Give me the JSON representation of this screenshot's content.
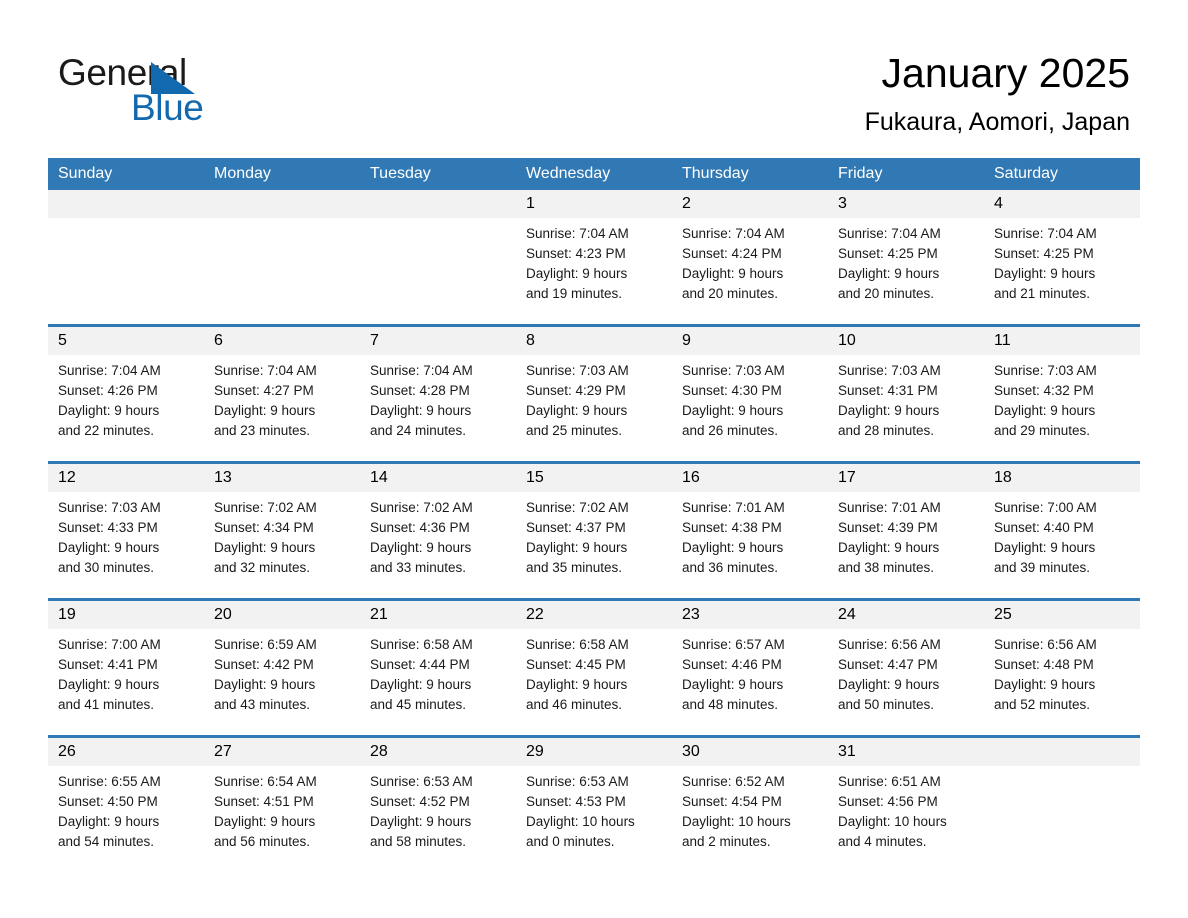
{
  "brand": {
    "name_part1": "General",
    "name_part2": "Blue",
    "logo_icon": "triangle-flag-icon",
    "accent_color": "#1369ad"
  },
  "header": {
    "month_title": "January 2025",
    "location": "Fukaura, Aomori, Japan"
  },
  "calendar": {
    "header_bg": "#3179b4",
    "daynum_bg": "#f2f2f2",
    "weekday_headers": [
      "Sunday",
      "Monday",
      "Tuesday",
      "Wednesday",
      "Thursday",
      "Friday",
      "Saturday"
    ],
    "weeks": [
      [
        {
          "day": "",
          "lines": []
        },
        {
          "day": "",
          "lines": []
        },
        {
          "day": "",
          "lines": []
        },
        {
          "day": "1",
          "lines": [
            "Sunrise: 7:04 AM",
            "Sunset: 4:23 PM",
            "Daylight: 9 hours",
            "and 19 minutes."
          ]
        },
        {
          "day": "2",
          "lines": [
            "Sunrise: 7:04 AM",
            "Sunset: 4:24 PM",
            "Daylight: 9 hours",
            "and 20 minutes."
          ]
        },
        {
          "day": "3",
          "lines": [
            "Sunrise: 7:04 AM",
            "Sunset: 4:25 PM",
            "Daylight: 9 hours",
            "and 20 minutes."
          ]
        },
        {
          "day": "4",
          "lines": [
            "Sunrise: 7:04 AM",
            "Sunset: 4:25 PM",
            "Daylight: 9 hours",
            "and 21 minutes."
          ]
        }
      ],
      [
        {
          "day": "5",
          "lines": [
            "Sunrise: 7:04 AM",
            "Sunset: 4:26 PM",
            "Daylight: 9 hours",
            "and 22 minutes."
          ]
        },
        {
          "day": "6",
          "lines": [
            "Sunrise: 7:04 AM",
            "Sunset: 4:27 PM",
            "Daylight: 9 hours",
            "and 23 minutes."
          ]
        },
        {
          "day": "7",
          "lines": [
            "Sunrise: 7:04 AM",
            "Sunset: 4:28 PM",
            "Daylight: 9 hours",
            "and 24 minutes."
          ]
        },
        {
          "day": "8",
          "lines": [
            "Sunrise: 7:03 AM",
            "Sunset: 4:29 PM",
            "Daylight: 9 hours",
            "and 25 minutes."
          ]
        },
        {
          "day": "9",
          "lines": [
            "Sunrise: 7:03 AM",
            "Sunset: 4:30 PM",
            "Daylight: 9 hours",
            "and 26 minutes."
          ]
        },
        {
          "day": "10",
          "lines": [
            "Sunrise: 7:03 AM",
            "Sunset: 4:31 PM",
            "Daylight: 9 hours",
            "and 28 minutes."
          ]
        },
        {
          "day": "11",
          "lines": [
            "Sunrise: 7:03 AM",
            "Sunset: 4:32 PM",
            "Daylight: 9 hours",
            "and 29 minutes."
          ]
        }
      ],
      [
        {
          "day": "12",
          "lines": [
            "Sunrise: 7:03 AM",
            "Sunset: 4:33 PM",
            "Daylight: 9 hours",
            "and 30 minutes."
          ]
        },
        {
          "day": "13",
          "lines": [
            "Sunrise: 7:02 AM",
            "Sunset: 4:34 PM",
            "Daylight: 9 hours",
            "and 32 minutes."
          ]
        },
        {
          "day": "14",
          "lines": [
            "Sunrise: 7:02 AM",
            "Sunset: 4:36 PM",
            "Daylight: 9 hours",
            "and 33 minutes."
          ]
        },
        {
          "day": "15",
          "lines": [
            "Sunrise: 7:02 AM",
            "Sunset: 4:37 PM",
            "Daylight: 9 hours",
            "and 35 minutes."
          ]
        },
        {
          "day": "16",
          "lines": [
            "Sunrise: 7:01 AM",
            "Sunset: 4:38 PM",
            "Daylight: 9 hours",
            "and 36 minutes."
          ]
        },
        {
          "day": "17",
          "lines": [
            "Sunrise: 7:01 AM",
            "Sunset: 4:39 PM",
            "Daylight: 9 hours",
            "and 38 minutes."
          ]
        },
        {
          "day": "18",
          "lines": [
            "Sunrise: 7:00 AM",
            "Sunset: 4:40 PM",
            "Daylight: 9 hours",
            "and 39 minutes."
          ]
        }
      ],
      [
        {
          "day": "19",
          "lines": [
            "Sunrise: 7:00 AM",
            "Sunset: 4:41 PM",
            "Daylight: 9 hours",
            "and 41 minutes."
          ]
        },
        {
          "day": "20",
          "lines": [
            "Sunrise: 6:59 AM",
            "Sunset: 4:42 PM",
            "Daylight: 9 hours",
            "and 43 minutes."
          ]
        },
        {
          "day": "21",
          "lines": [
            "Sunrise: 6:58 AM",
            "Sunset: 4:44 PM",
            "Daylight: 9 hours",
            "and 45 minutes."
          ]
        },
        {
          "day": "22",
          "lines": [
            "Sunrise: 6:58 AM",
            "Sunset: 4:45 PM",
            "Daylight: 9 hours",
            "and 46 minutes."
          ]
        },
        {
          "day": "23",
          "lines": [
            "Sunrise: 6:57 AM",
            "Sunset: 4:46 PM",
            "Daylight: 9 hours",
            "and 48 minutes."
          ]
        },
        {
          "day": "24",
          "lines": [
            "Sunrise: 6:56 AM",
            "Sunset: 4:47 PM",
            "Daylight: 9 hours",
            "and 50 minutes."
          ]
        },
        {
          "day": "25",
          "lines": [
            "Sunrise: 6:56 AM",
            "Sunset: 4:48 PM",
            "Daylight: 9 hours",
            "and 52 minutes."
          ]
        }
      ],
      [
        {
          "day": "26",
          "lines": [
            "Sunrise: 6:55 AM",
            "Sunset: 4:50 PM",
            "Daylight: 9 hours",
            "and 54 minutes."
          ]
        },
        {
          "day": "27",
          "lines": [
            "Sunrise: 6:54 AM",
            "Sunset: 4:51 PM",
            "Daylight: 9 hours",
            "and 56 minutes."
          ]
        },
        {
          "day": "28",
          "lines": [
            "Sunrise: 6:53 AM",
            "Sunset: 4:52 PM",
            "Daylight: 9 hours",
            "and 58 minutes."
          ]
        },
        {
          "day": "29",
          "lines": [
            "Sunrise: 6:53 AM",
            "Sunset: 4:53 PM",
            "Daylight: 10 hours",
            "and 0 minutes."
          ]
        },
        {
          "day": "30",
          "lines": [
            "Sunrise: 6:52 AM",
            "Sunset: 4:54 PM",
            "Daylight: 10 hours",
            "and 2 minutes."
          ]
        },
        {
          "day": "31",
          "lines": [
            "Sunrise: 6:51 AM",
            "Sunset: 4:56 PM",
            "Daylight: 10 hours",
            "and 4 minutes."
          ]
        },
        {
          "day": "",
          "lines": []
        }
      ]
    ]
  }
}
